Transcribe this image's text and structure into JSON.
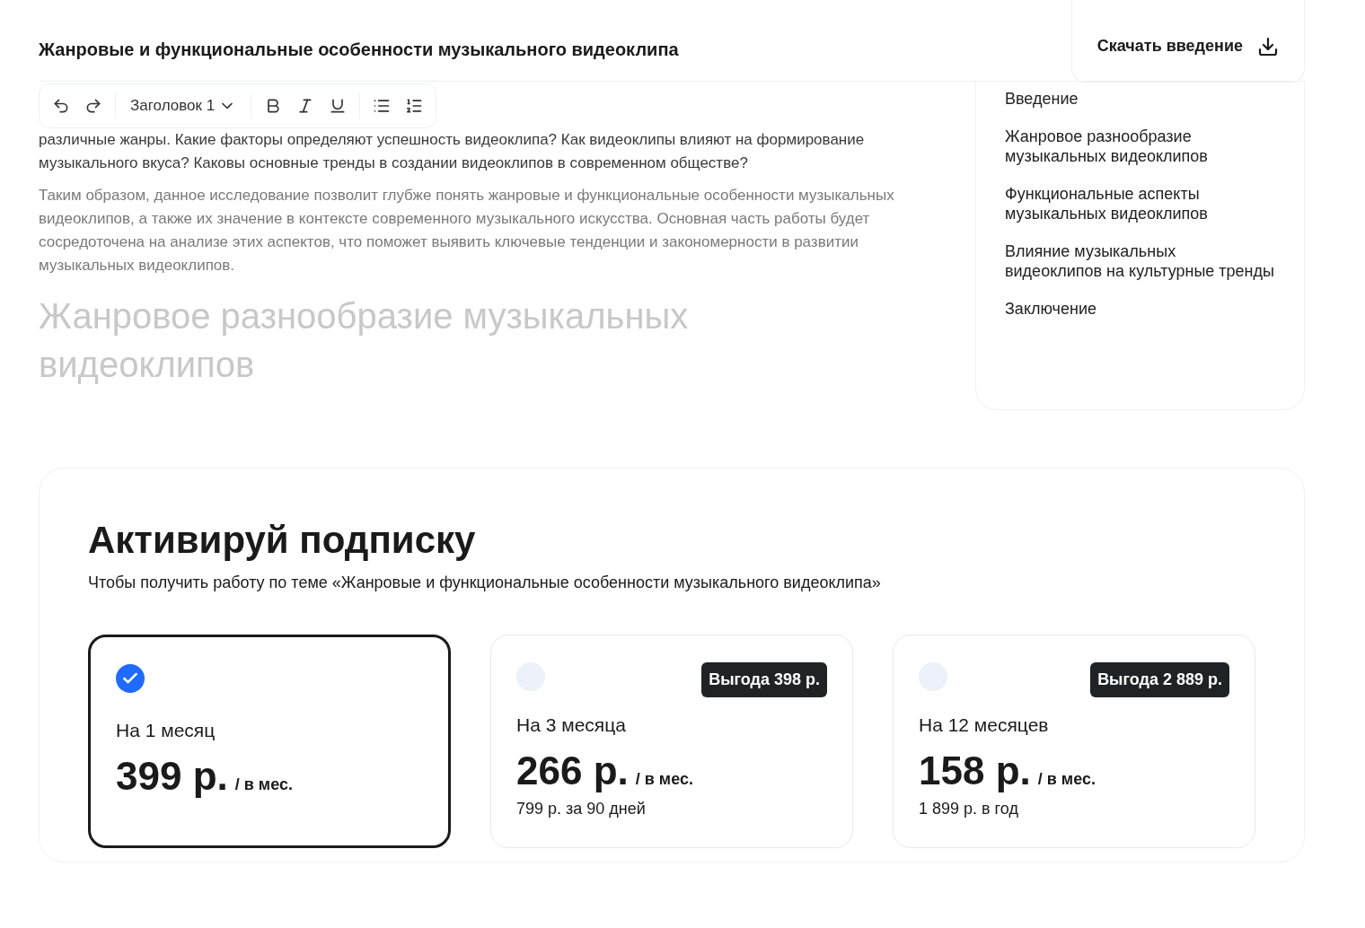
{
  "header": {
    "title": "Жанровые и функциональные особенности музыкального видеоклипа",
    "download_button": "Скачать введение"
  },
  "toolbar": {
    "heading_select": "Заголовок 1"
  },
  "editor": {
    "paragraphs": [
      "различные жанры. Какие факторы определяют успешность видеоклипа? Как видеоклипы влияют на формирование музыкального вкуса? Каковы основные тренды в создании видеоклипов в современном обществе?",
      "Таким образом, данное исследование позволит глубже понять жанровые и функциональные особенности музыкальных видеоклипов, а также их значение в контексте современного музыкального искусства. Основная часть работы будет сосредоточена на анализе этих аспектов, что поможет выявить ключевые тенденции и закономерности в развитии музыкальных видеоклипов."
    ],
    "heading": "Жанровое разнообразие музыкальных видеоклипов"
  },
  "toc": [
    "Введение",
    "Жанровое разнообразие музыкальных видеоклипов",
    "Функциональные аспекты музыкальных видеоклипов",
    "Влияние музыкальных видеоклипов на культурные тренды",
    "Заключение"
  ],
  "subscription": {
    "title": "Активируй подписку",
    "subtitle": "Чтобы получить работу по теме «Жанровые и функциональные особенности музыкального видеоклипа»",
    "plans": [
      {
        "selected": true,
        "name": "На 1 месяц",
        "price": "399 р.",
        "per": "/ в мес."
      },
      {
        "selected": false,
        "badge": "Выгода 398 р.",
        "name": "На 3 месяца",
        "price": "266 р.",
        "per": "/ в мес.",
        "note": "799 р. за 90 дней"
      },
      {
        "selected": false,
        "badge": "Выгода 2 889 р.",
        "name": "На 12 месяцев",
        "price": "158 р.",
        "per": "/ в мес.",
        "note": "1 899 р. в год"
      }
    ]
  }
}
